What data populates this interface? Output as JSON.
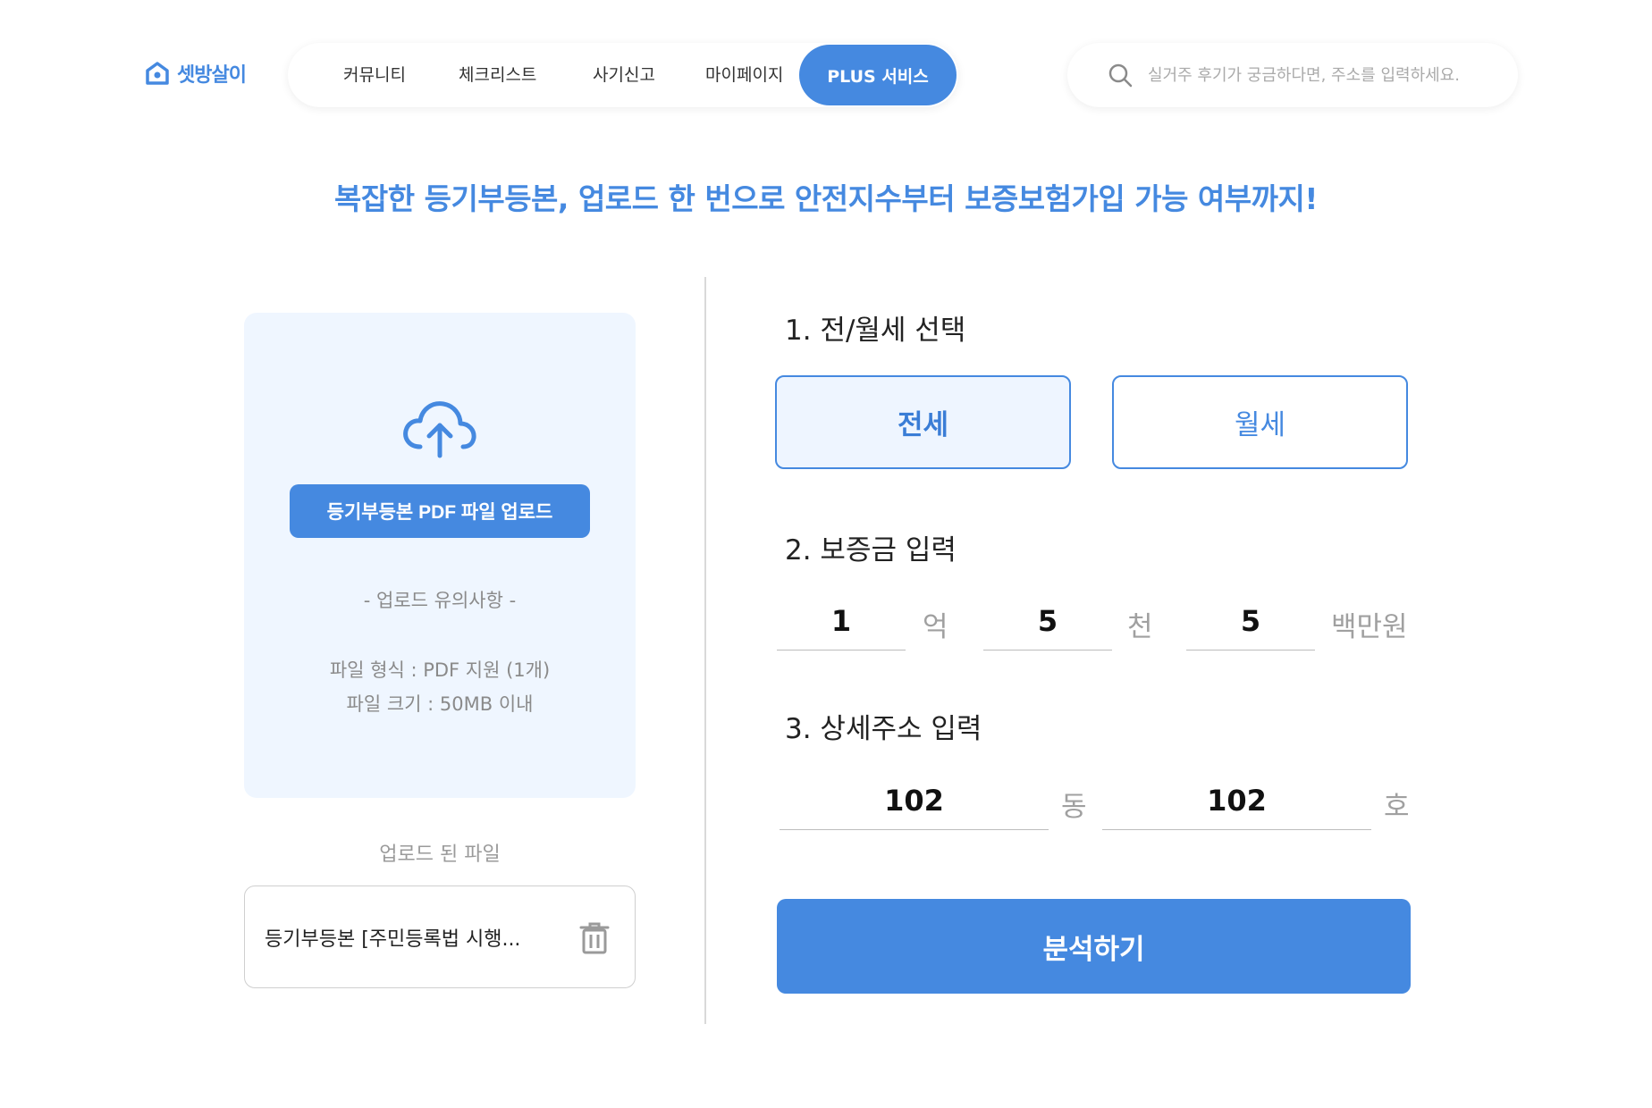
{
  "header": {
    "logo_text": "셋방살이",
    "nav": [
      {
        "label": "커뮤니티"
      },
      {
        "label": "체크리스트"
      },
      {
        "label": "사기신고"
      },
      {
        "label": "마이페이지"
      }
    ],
    "plus_label": "PLUS 서비스",
    "search_placeholder": "실거주 후기가 궁금하다면, 주소를 입력하세요."
  },
  "headline": "복잡한 등기부등본, 업로드 한 번으로 안전지수부터 보증보험가입 가능 여부까지!",
  "upload": {
    "button_label": "등기부등본 PDF 파일 업로드",
    "notice_title": "- 업로드 유의사항 -",
    "notice_lines": [
      "파일 형식 : PDF 지원 (1개)",
      "파일 크기 : 50MB 이내"
    ]
  },
  "uploaded": {
    "label": "업로드 된 파일",
    "file_name": "등기부등본 [주민등록법 시행..."
  },
  "form": {
    "step1_title": "1. 전/월세 선택",
    "options": [
      {
        "label": "전세",
        "selected": true
      },
      {
        "label": "월세",
        "selected": false
      }
    ],
    "step2_title": "2. 보증금 입력",
    "deposit": [
      {
        "value": "1",
        "unit": "억"
      },
      {
        "value": "5",
        "unit": "천"
      },
      {
        "value": "5",
        "unit": "백만원"
      }
    ],
    "step3_title": "3. 상세주소 입력",
    "address": [
      {
        "value": "102",
        "unit": "동"
      },
      {
        "value": "102",
        "unit": "호"
      }
    ],
    "submit_label": "분석하기"
  },
  "colors": {
    "accent": "#4589e0",
    "upload_bg": "#eff6ff"
  }
}
